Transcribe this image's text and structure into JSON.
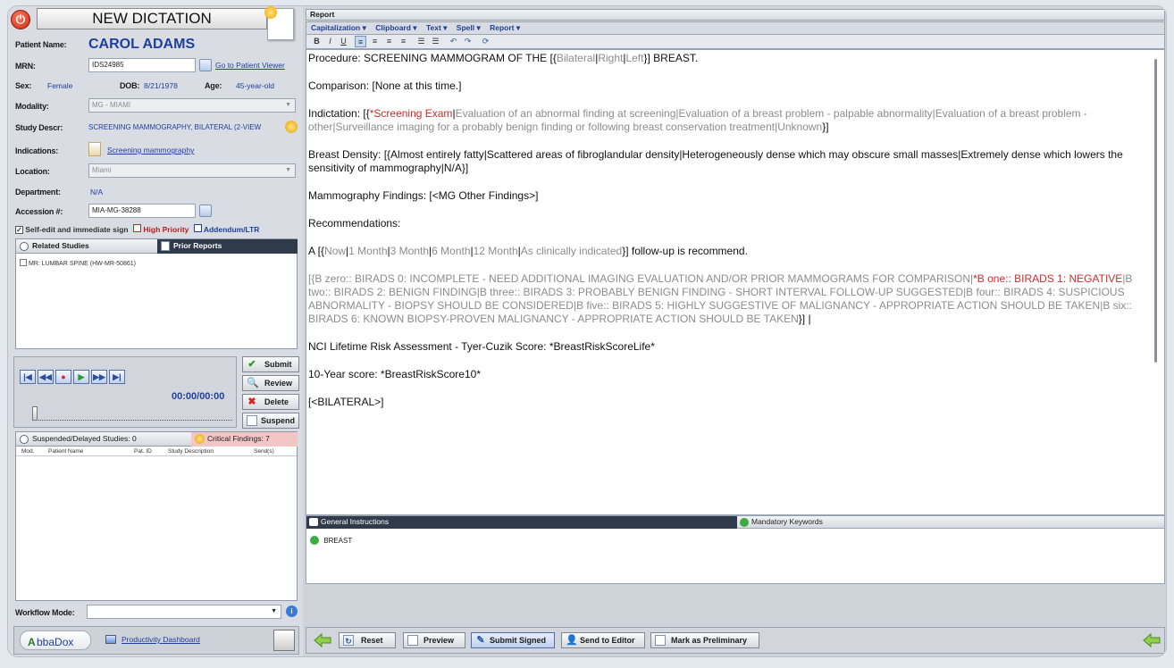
{
  "app": {
    "power_label": "⏻",
    "title": "NEW DICTATION"
  },
  "patient": {
    "name_label": "Patient Name:",
    "name": "CAROL ADAMS",
    "mrn_label": "MRN:",
    "mrn": "IDS24985",
    "patient_viewer_link": "Go to Patient Viewer",
    "sex_label": "Sex:",
    "sex": "Female",
    "dob_label": "DOB:",
    "dob": "8/21/1978",
    "age_label": "Age:",
    "age": "45-year-old",
    "modality_label": "Modality:",
    "modality": "MG - MIAMI",
    "study_label": "Study Descr:",
    "study": "SCREENING MAMMOGRAPHY, BILATERAL (2-VIEW",
    "indications_label": "Indications:",
    "indications_link": "Screening mammography",
    "location_label": "Location:",
    "location": "Miami",
    "department_label": "Department:",
    "department": "N/A",
    "accession_label": "Accession #:",
    "accession": "MIA-MG-38288"
  },
  "options": {
    "self_edit": "Self-edit and immediate sign",
    "high_priority": "High Priority",
    "addendum": "Addendum/LTR"
  },
  "studies": {
    "tab_related": "Related Studies",
    "tab_prior": "Prior Reports",
    "items": [
      "MR: LUMBAR SPINE (HW-MR-50861)"
    ]
  },
  "player": {
    "time": "00:00/00:00"
  },
  "actions": {
    "submit": "Submit",
    "review": "Review",
    "delete": "Delete",
    "suspend": "Suspend"
  },
  "suspended": {
    "tab_suspended": "Suspended/Delayed Studies: 0",
    "tab_critical": "Critical Findings: 7",
    "columns": [
      "Mod.",
      "Patient Name",
      "Pat. ID",
      "Study Description",
      "Send(s)"
    ]
  },
  "workflow": {
    "label": "Workflow Mode:",
    "value": "",
    "info_label": "i"
  },
  "footer_left": {
    "logo": "bbaDox",
    "logo_mark": "A",
    "dashboard_link": "Productivity Dashboard"
  },
  "report": {
    "header": "Report",
    "menu": [
      "Capitalization ▾",
      "Clipboard ▾",
      "Text ▾",
      "Spell ▾",
      "Report ▾"
    ],
    "toolbar": [
      "B",
      "I",
      "U",
      "≡",
      "≡",
      "≡",
      "≡",
      "☰",
      "☰",
      "↶",
      "↷",
      "⟳"
    ],
    "procedure_prefix": "Procedure: SCREENING MAMMOGRAM OF THE [{",
    "procedure_opt1": "Bilateral",
    "procedure_opt2": "Right",
    "procedure_opt3": "Left",
    "procedure_suffix": "}] BREAST.",
    "comparison": "Comparison: [None at this time.]",
    "indication_prefix": "Indictation: [{",
    "indication_selected": "*Screening Exam",
    "indication_options": "Evaluation of an abnormal finding at screening|Evaluation of a breast problem - palpable abnormality|Evaluation of a breast problem - other|Surveillance imaging for a probably benign finding or following breast conservation treatment|Unknown",
    "indication_suffix": "}]",
    "density": "Breast Density: [{Almost entirely fatty|Scattered areas of fibroglandular density|Heterogeneously dense which may obscure small masses|Extremely dense which lowers the sensitivity of mammography|N/A}]",
    "findings": "Mammography Findings: [<MG Other Findings>]",
    "recommendations": "Recommendations:",
    "followup_prefix": "A [{",
    "followup_opt1": "Now",
    "followup_opt2": "1 Month",
    "followup_opt3": "3 Month",
    "followup_opt4": "6 Month",
    "followup_opt5": "12 Month",
    "followup_opt6": "As clinically indicated",
    "followup_suffix": "}] follow-up is recommend.",
    "birads_a": "[{B zero:: BIRADS 0:  INCOMPLETE - NEED ADDITIONAL IMAGING EVALUATION AND/OR PRIOR MAMMOGRAMS FOR COMPARISON|",
    "birads_b": "*B one:: BIRADS 1:  NEGATIVE",
    "birads_c": "|B two:: BIRADS 2:  BENIGN FINDING|B three:: BIRADS 3:  PROBABLY BENIGN FINDING - SHORT INTERVAL FOLLOW-UP SUGGESTED|B four:: BIRADS 4:  SUSPICIOUS ABNORMALITY - BIOPSY SHOULD BE CONSIDERED|B five:: BIRADS 5:  HIGHLY SUGGESTIVE OF MALIGNANCY - APPROPRIATE ACTION SHOULD BE TAKEN|B six:: BIRADS 6:  KNOWN BIOPSY-PROVEN MALIGNANCY - APPROPRIATE ACTION SHOULD BE TAKEN",
    "birads_d": "}] |",
    "nci": "NCI Lifetime Risk Assessment - Tyer-Cuzik Score: *BreastRiskScoreLife*",
    "ten_year": "10-Year score: *BreastRiskScore10*",
    "bilateral": "[<BILATERAL>]"
  },
  "instructions": {
    "tab_general": "General Instructions",
    "tab_mandatory": "Mandatory Keywords",
    "keywords": [
      "BREAST"
    ]
  },
  "report_actions": {
    "reset": "Reset",
    "preview": "Preview",
    "submit_signed": "Submit Signed",
    "send_to_editor": "Send to Editor",
    "mark_preliminary": "Mark as Preliminary"
  },
  "colors": {
    "accent_blue": "#1e3f9c",
    "required_red": "#d42a2a",
    "option_gray": "#8c8c8c"
  }
}
